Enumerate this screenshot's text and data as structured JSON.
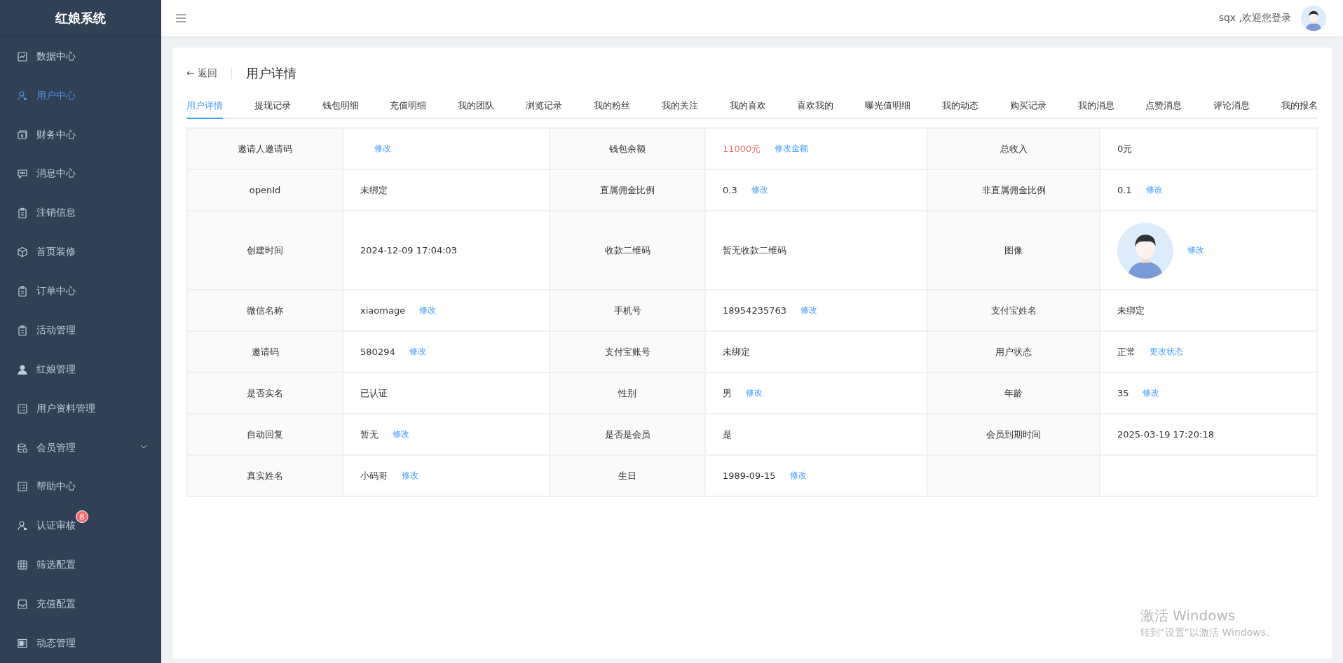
{
  "sidebar": {
    "title": "红娘系统",
    "items": [
      {
        "label": "数据中心",
        "selected": false
      },
      {
        "label": "用户中心",
        "selected": true
      },
      {
        "label": "财务中心",
        "selected": false
      },
      {
        "label": "消息中心",
        "selected": false
      },
      {
        "label": "注销信息",
        "selected": false
      },
      {
        "label": "首页装修",
        "selected": false
      },
      {
        "label": "订单中心",
        "selected": false
      },
      {
        "label": "活动管理",
        "selected": false
      },
      {
        "label": "红娘管理",
        "selected": false
      },
      {
        "label": "用户资料管理",
        "selected": false
      },
      {
        "label": "会员管理",
        "selected": false,
        "expanded": false
      },
      {
        "label": "帮助中心",
        "selected": false
      },
      {
        "label": "认证审核",
        "selected": false,
        "badge": "8"
      },
      {
        "label": "筛选配置",
        "selected": false
      },
      {
        "label": "充值配置",
        "selected": false
      },
      {
        "label": "动态管理",
        "selected": false
      }
    ]
  },
  "header": {
    "greeting": "sqx ,欢迎您登录"
  },
  "page": {
    "back": "← 返回",
    "title": "用户详情"
  },
  "tabs": [
    {
      "label": "用户详情",
      "selected": true
    },
    {
      "label": "提现记录",
      "selected": false
    },
    {
      "label": "钱包明细",
      "selected": false
    },
    {
      "label": "充值明细",
      "selected": false
    },
    {
      "label": "我的团队",
      "selected": false
    },
    {
      "label": "浏览记录",
      "selected": false
    },
    {
      "label": "我的粉丝",
      "selected": false
    },
    {
      "label": "我的关注",
      "selected": false
    },
    {
      "label": "我的喜欢",
      "selected": false
    },
    {
      "label": "喜欢我的",
      "selected": false
    },
    {
      "label": "曝光值明细",
      "selected": false
    },
    {
      "label": "我的动态",
      "selected": false
    },
    {
      "label": "购买记录",
      "selected": false
    },
    {
      "label": "我的消息",
      "selected": false
    },
    {
      "label": "点赞消息",
      "selected": false
    },
    {
      "label": "评论消息",
      "selected": false
    },
    {
      "label": "我的报名",
      "selected": false
    }
  ],
  "details": {
    "rows": [
      [
        {
          "label": "邀请人邀请码",
          "kind": "text",
          "action": "修改"
        },
        {
          "label": "钱包余额",
          "kind": "amount",
          "value": "11000元",
          "action": "修改金额"
        },
        {
          "label": "总收入",
          "kind": "text",
          "value": "0元"
        }
      ],
      [
        {
          "label": "openId",
          "kind": "text",
          "value": "未绑定"
        },
        {
          "label": "直属佣金比例",
          "kind": "text",
          "value": "0.3",
          "action": "修改"
        },
        {
          "label": "非直属佣金比例",
          "kind": "text",
          "value": "0.1",
          "action": "修改"
        }
      ],
      [
        {
          "label": "创建时间",
          "kind": "text",
          "value": "2024-12-09 17:04:03"
        },
        {
          "label": "收款二维码",
          "kind": "text",
          "value": "暂无收款二维码"
        },
        {
          "label": "图像",
          "kind": "avatar",
          "action": "修改"
        }
      ],
      [
        {
          "label": "微信名称",
          "kind": "text",
          "value": "xiaomage",
          "action": "修改"
        },
        {
          "label": "手机号",
          "kind": "text",
          "value": "18954235763",
          "action": "修改"
        },
        {
          "label": "支付宝姓名",
          "kind": "text",
          "value": "未绑定"
        }
      ],
      [
        {
          "label": "邀请码",
          "kind": "text",
          "value": "580294",
          "action": "修改"
        },
        {
          "label": "支付宝账号",
          "kind": "text",
          "value": "未绑定"
        },
        {
          "label": "用户状态",
          "kind": "text",
          "value": "正常",
          "action": "更改状态"
        }
      ],
      [
        {
          "label": "是否实名",
          "kind": "text",
          "value": "已认证"
        },
        {
          "label": "性别",
          "kind": "text",
          "value": "男",
          "action": "修改"
        },
        {
          "label": "年龄",
          "kind": "text",
          "value": "35",
          "action": "修改"
        }
      ],
      [
        {
          "label": "自动回复",
          "kind": "text",
          "value": "暂无",
          "action": "修改"
        },
        {
          "label": "是否是会员",
          "kind": "text",
          "value": "是"
        },
        {
          "label": "会员到期时间",
          "kind": "text",
          "value": "2025-03-19 17:20:18"
        }
      ],
      [
        {
          "label": "真实姓名",
          "kind": "text",
          "value": "小码哥",
          "action": "修改"
        },
        {
          "label": "生日",
          "kind": "text",
          "value": "1989-09-15",
          "action": "修改"
        }
      ]
    ]
  },
  "os_notice": {
    "title": "激活 Windows",
    "text": "转到“设置”以激活 Windows。"
  }
}
